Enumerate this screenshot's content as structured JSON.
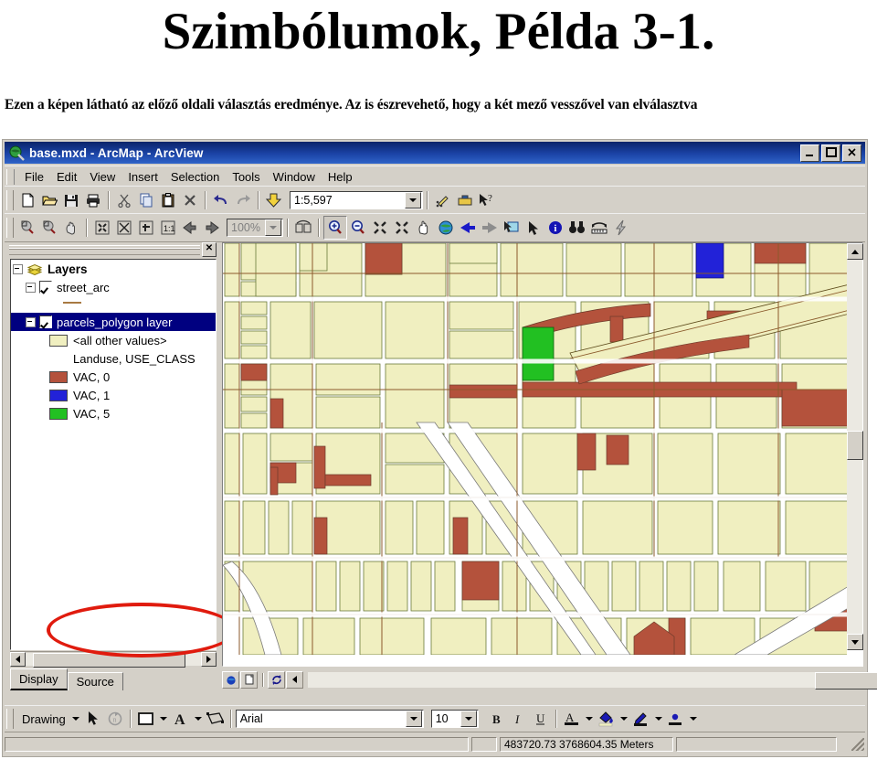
{
  "slide": {
    "title": "Szimbólumok, Példa 3-1.",
    "subtitle": "Ezen a képen látható az előző oldali választás eredménye. Az is észrevehető, hogy a két mező vesszővel van elválasztva"
  },
  "window": {
    "title": "base.mxd - ArcMap - ArcView",
    "icon": "arcmap-globe-icon",
    "controls": {
      "minimize": "_",
      "maximize": "❐",
      "close": "✕"
    }
  },
  "menu": {
    "items": [
      {
        "label": "File",
        "accel": "F"
      },
      {
        "label": "Edit",
        "accel": "E"
      },
      {
        "label": "View",
        "accel": "V"
      },
      {
        "label": "Insert",
        "accel": "I"
      },
      {
        "label": "Selection",
        "accel": "S"
      },
      {
        "label": "Tools",
        "accel": "T"
      },
      {
        "label": "Window",
        "accel": "W"
      },
      {
        "label": "Help",
        "accel": "H"
      }
    ]
  },
  "standard_toolbar": {
    "buttons": [
      "new-document-icon",
      "open-folder-icon",
      "save-icon",
      "print-icon",
      "cut-scissors-icon",
      "copy-icon",
      "paste-icon",
      "delete-x-icon",
      "undo-arrow-icon",
      "redo-arrow-icon",
      "add-data-icon"
    ],
    "scale_combo": {
      "value": "1:5,597",
      "name": "map-scale-combo"
    },
    "right_buttons": [
      "editor-toolbar-icon",
      "arctoolbox-icon",
      "context-help-icon"
    ]
  },
  "tools_toolbar": {
    "left_buttons": [
      "zoom-in-rect-icon",
      "zoom-out-rect-icon",
      "pan-hand-icon",
      "fixed-zoom-in-icon",
      "fixed-zoom-out-icon",
      "full-extent-icon",
      "scale-1to1-icon",
      "back-extent-icon",
      "forward-extent-icon"
    ],
    "zoom_combo": {
      "value": "100%",
      "name": "page-zoom-combo",
      "disabled": true
    },
    "toggle_button": "toggle-draft-mode-icon",
    "right_buttons": [
      "zoom-in-icon",
      "zoom-out-icon",
      "fixed-zoom-in2-icon",
      "fixed-zoom-out2-icon",
      "pan-icon",
      "full-extent-globe-icon",
      "go-back-extent-icon",
      "go-next-extent-icon",
      "select-features-icon",
      "select-elements-arrow-icon",
      "identify-icon",
      "find-binoculars-icon",
      "measure-icon",
      "hyperlink-lightning-icon"
    ]
  },
  "toc": {
    "close_label": "✕",
    "root": {
      "label": "Layers",
      "icon": "layers-stack-icon",
      "expanded": true
    },
    "nodes": [
      {
        "label": "street_arc",
        "checked": true,
        "expanded": true,
        "selected": false,
        "swatch": null
      },
      {
        "label": "parcels_polygon layer",
        "checked": true,
        "expanded": true,
        "selected": true,
        "swatch": null
      }
    ],
    "legend": [
      {
        "label": "<all other values>",
        "swatch": "#f0efc0"
      },
      {
        "label": "Landuse, USE_CLASS",
        "swatch": null
      },
      {
        "label": "VAC, 0",
        "swatch": "#b4523c"
      },
      {
        "label": "VAC, 1",
        "swatch": "#2222d8"
      },
      {
        "label": "VAC, 5",
        "swatch": "#22c022"
      }
    ],
    "tabs": [
      {
        "label": "Display",
        "active": true
      },
      {
        "label": "Source",
        "active": false
      }
    ],
    "annotation": {
      "type": "red-ellipse-highlight",
      "color": "#e01b0e"
    }
  },
  "map_bottom_bar": {
    "buttons": [
      "data-view-icon",
      "layout-view-icon",
      "refresh-icon",
      "pause-drawing-icon"
    ]
  },
  "drawing_toolbar": {
    "label": "Drawing",
    "buttons": [
      "select-arrow-icon",
      "rotate-icon",
      "new-rectangle-icon",
      "new-text-icon",
      "group-icon"
    ],
    "font_combo": {
      "value": "Arial",
      "name": "font-family-combo"
    },
    "size_combo": {
      "value": "10",
      "name": "font-size-combo"
    },
    "bold": "B",
    "italic": "I",
    "underline": "U",
    "color_buttons": [
      "font-color-icon",
      "fill-color-icon",
      "line-color-icon",
      "marker-color-icon"
    ]
  },
  "status_bar": {
    "coordinates": "483720.73  3768604.35 Meters",
    "message": ""
  },
  "colors": {
    "parcel_fill": "#f0efc0",
    "parcel_vac0": "#b4523c",
    "parcel_vac1": "#2222d8",
    "parcel_vac5": "#22c022",
    "street_line": "#8b5a2b",
    "parcel_outline": "#556b2f",
    "window_chrome": "#d4d0c8",
    "titlebar": "#0a246a",
    "selection": "#000080",
    "annotation_red": "#e01b0e"
  }
}
